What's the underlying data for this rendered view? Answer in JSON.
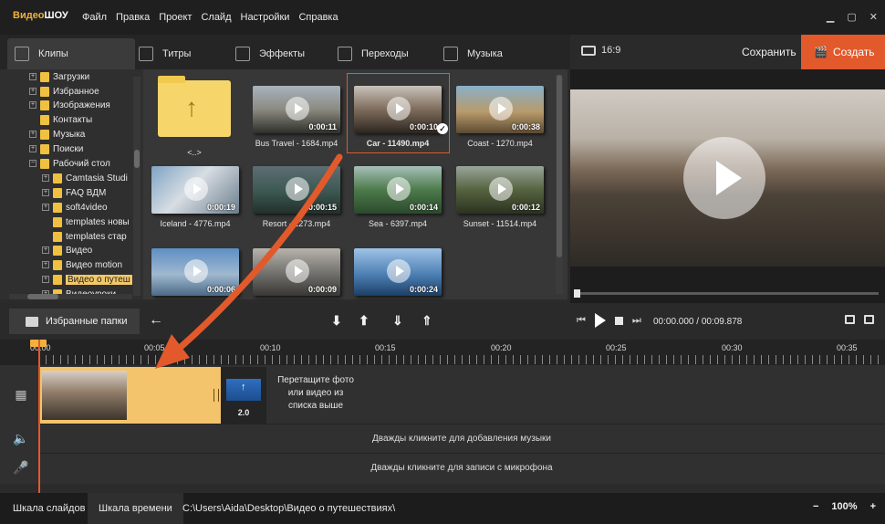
{
  "app": {
    "logo_part1": "Видео",
    "logo_part2": "ШОУ"
  },
  "menu": [
    "Файл",
    "Правка",
    "Проект",
    "Слайд",
    "Настройки",
    "Справка"
  ],
  "window_controls": [
    "minimize-icon",
    "maximize-icon",
    "close-icon"
  ],
  "tabs": [
    {
      "label": "Клипы",
      "icon": "clips-icon",
      "active": true
    },
    {
      "label": "Титры",
      "icon": "titles-icon"
    },
    {
      "label": "Эффекты",
      "icon": "effects-icon"
    },
    {
      "label": "Переходы",
      "icon": "transitions-icon"
    },
    {
      "label": "Музыка",
      "icon": "music-icon"
    }
  ],
  "preview_bar": {
    "ratio": "16:9",
    "save": "Сохранить",
    "create": "Создать"
  },
  "tree": [
    {
      "label": "Загрузки",
      "level": 1
    },
    {
      "label": "Избранное",
      "level": 1
    },
    {
      "label": "Изображения",
      "level": 1
    },
    {
      "label": "Контакты",
      "level": 1
    },
    {
      "label": "Музыка",
      "level": 1
    },
    {
      "label": "Поиски",
      "level": 1
    },
    {
      "label": "Рабочий стол",
      "level": 1,
      "expanded": true
    },
    {
      "label": "Camtasia Studi",
      "level": 2
    },
    {
      "label": "FAQ ВДМ",
      "level": 2
    },
    {
      "label": "soft4video",
      "level": 2
    },
    {
      "label": "templates новы",
      "level": 2
    },
    {
      "label": "templates стар",
      "level": 2
    },
    {
      "label": "Видео",
      "level": 2
    },
    {
      "label": "Видео motion",
      "level": 2
    },
    {
      "label": "Видео о путеш",
      "level": 2,
      "selected": true
    },
    {
      "label": "Видеоуроки",
      "level": 2
    }
  ],
  "clips": [
    {
      "name": "<..>",
      "duration": "",
      "type": "folder-up"
    },
    {
      "name": "Bus Travel - 1684.mp4",
      "duration": "0:00:11"
    },
    {
      "name": "Car - 11490.mp4",
      "duration": "0:00:10",
      "selected": true
    },
    {
      "name": "Coast - 1270.mp4",
      "duration": "0:00:38"
    },
    {
      "name": "Iceland - 4776.mp4",
      "duration": "0:00:19"
    },
    {
      "name": "Resort - 1273.mp4",
      "duration": "0:00:15"
    },
    {
      "name": "Sea - 6397.mp4",
      "duration": "0:00:14"
    },
    {
      "name": "Sunset - 11514.mp4",
      "duration": "0:00:12"
    },
    {
      "name": "",
      "duration": "0:00:06"
    },
    {
      "name": "",
      "duration": "0:00:09"
    },
    {
      "name": "",
      "duration": "0:00:24"
    }
  ],
  "toolbar": {
    "favorites": "Избранные папки",
    "time_current": "00:00.000",
    "time_separator": " / ",
    "time_total": "00:09.878"
  },
  "ruler": [
    "00:00",
    "00:05",
    "00:10",
    "00:15",
    "00:20",
    "00:25",
    "00:30",
    "00:35"
  ],
  "timeline": {
    "transition_value": "2.0",
    "drop_hint": "Перетащите фото или видео из списка выше",
    "music_hint": "Дважды кликните для добавления музыки",
    "mic_hint": "Дважды кликните для записи с микрофона"
  },
  "status": {
    "tab_slides": "Шкала слайдов",
    "tab_timeline": "Шкала времени",
    "path": "C:\\Users\\Aida\\Desktop\\Видео о путешествиях\\",
    "zoom": "100%"
  },
  "colors": {
    "accent": "#e2592b",
    "selection": "#f3c46b",
    "background": "#2b2b2b"
  }
}
